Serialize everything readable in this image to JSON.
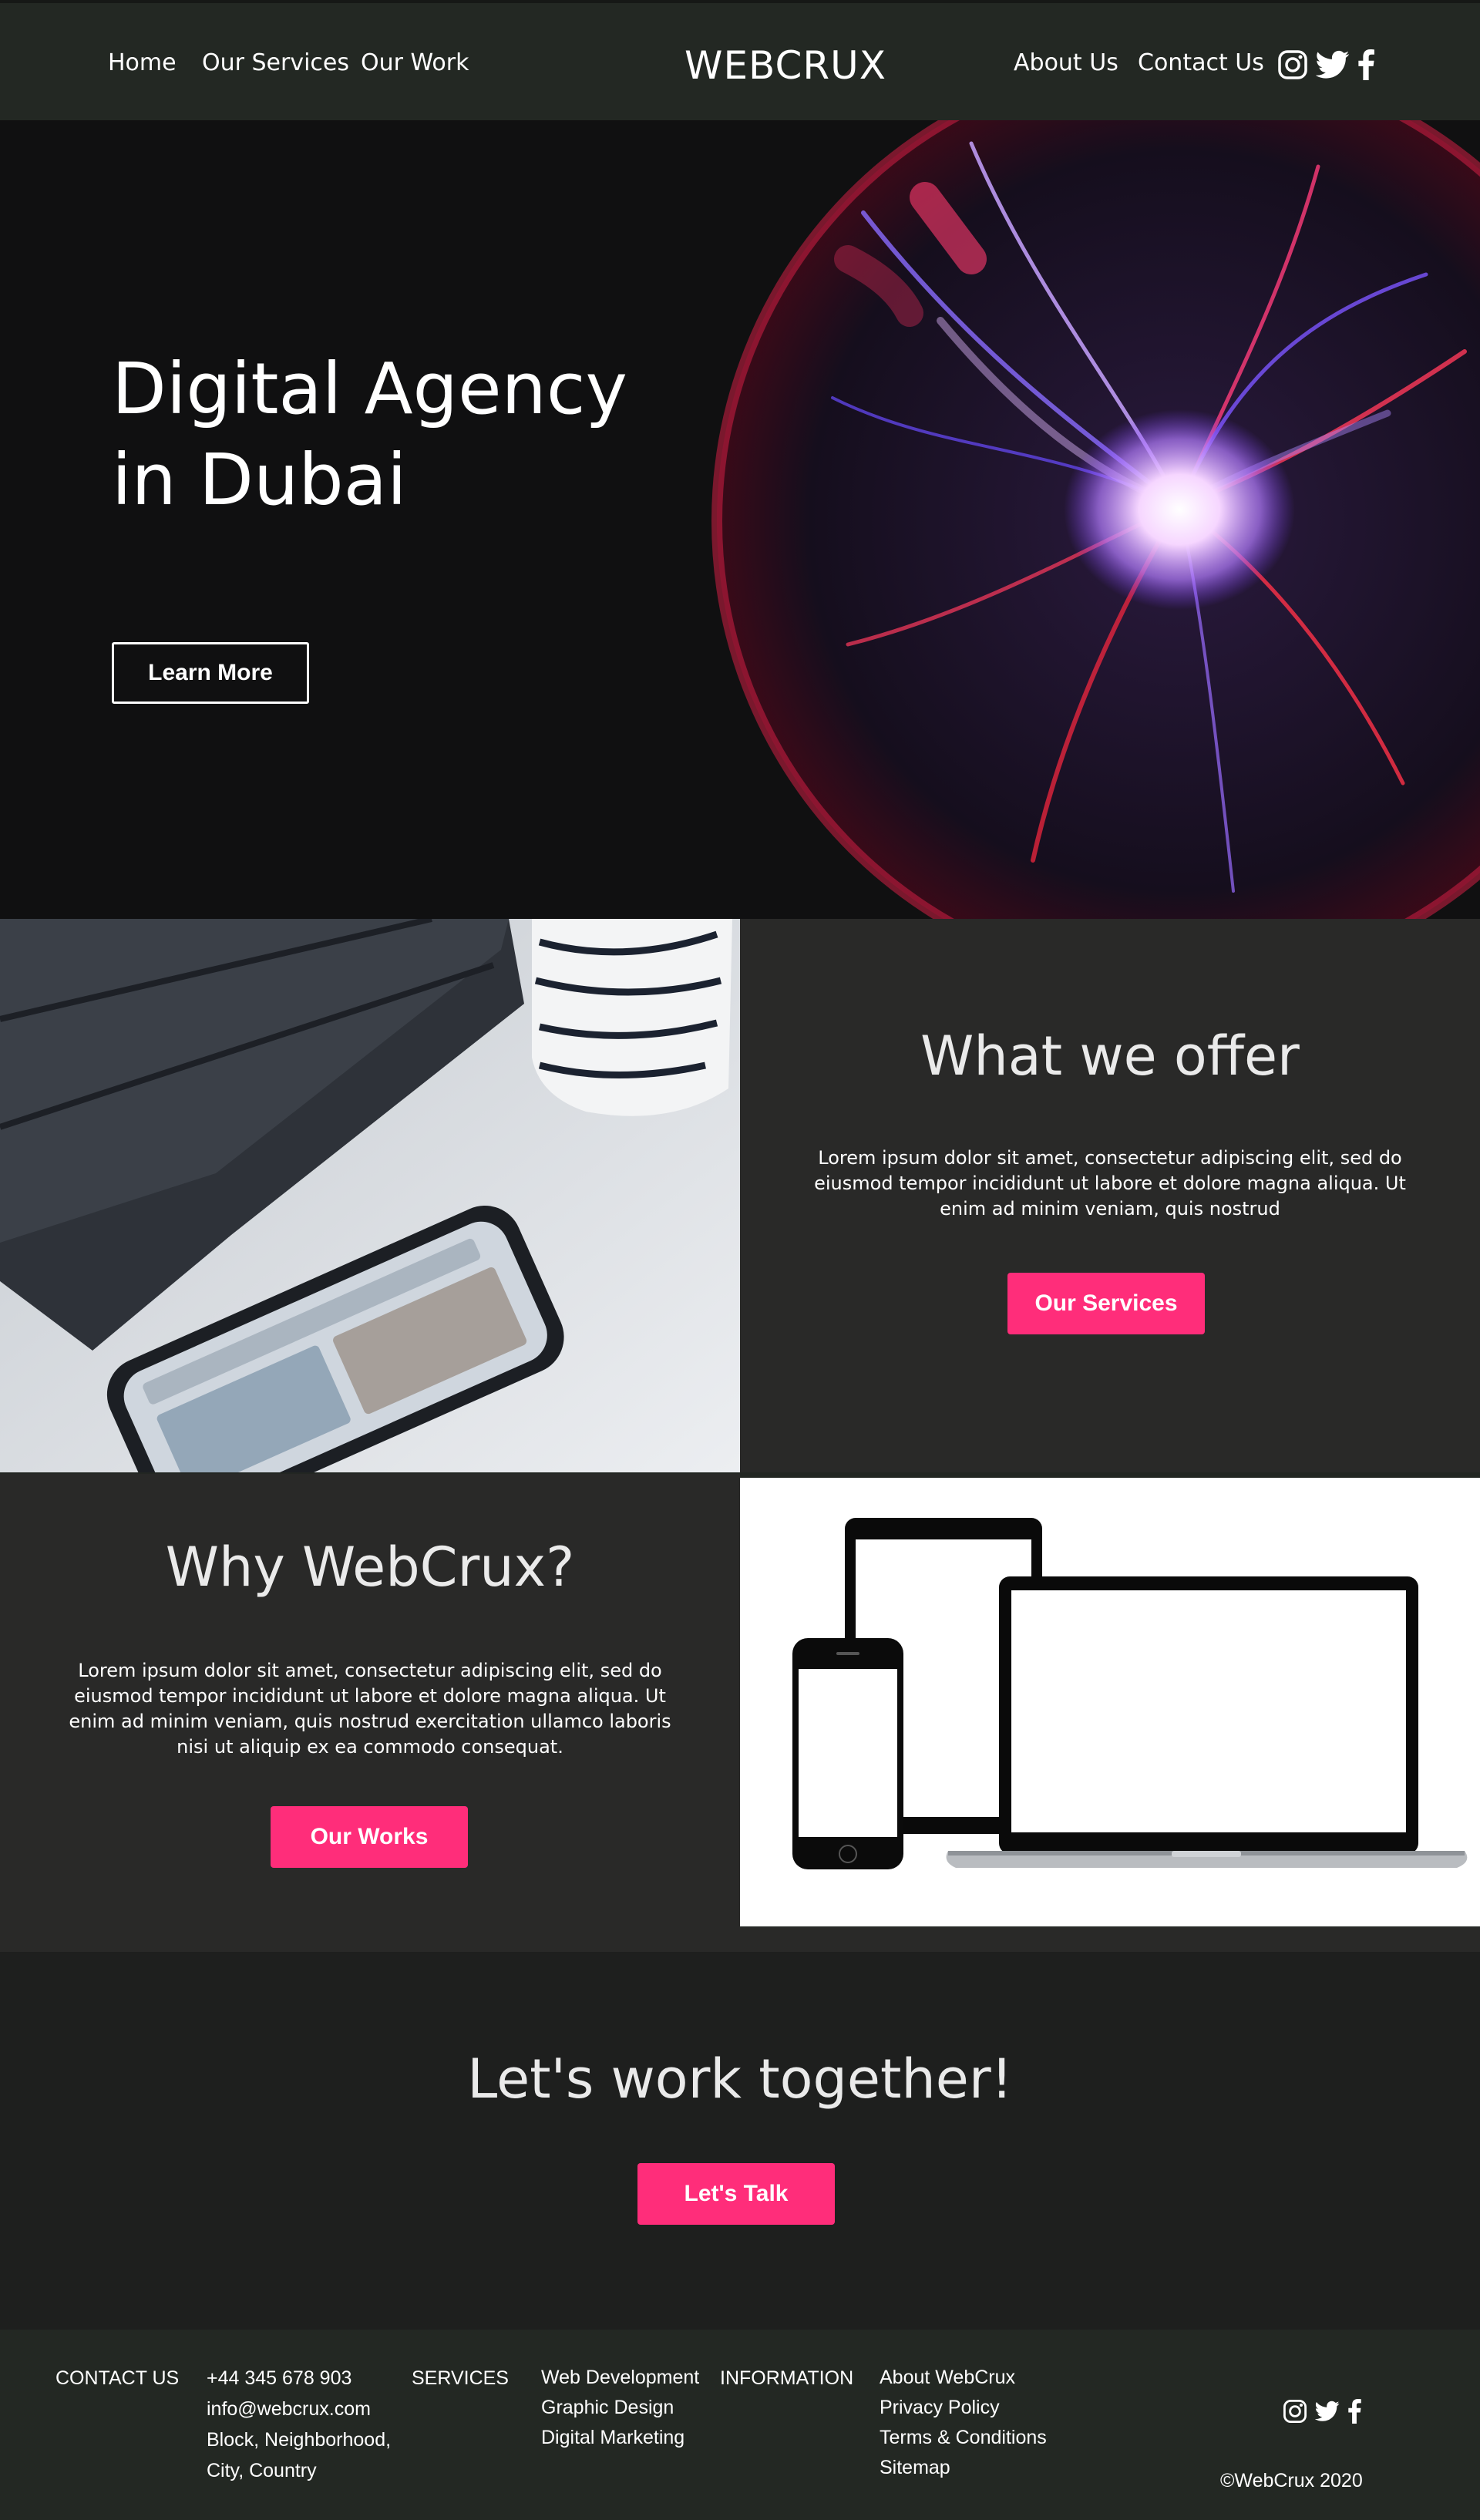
{
  "nav": {
    "left_links": [
      "Home",
      "Our Services",
      "Our Work"
    ],
    "brand": "WEBCRUX",
    "right_links": [
      "About Us",
      "Contact Us"
    ],
    "social_icons": [
      "instagram-icon",
      "twitter-icon",
      "facebook-icon"
    ]
  },
  "hero": {
    "title_line1": "Digital Agency",
    "title_line2": "in Dubai",
    "button": "Learn More"
  },
  "offer": {
    "title": "What we offer",
    "body": "Lorem ipsum dolor sit amet, consectetur adipiscing elit, sed do eiusmod tempor incididunt ut labore et dolore magna aliqua. Ut enim ad minim veniam, quis nostrud",
    "button": "Our Services"
  },
  "why": {
    "title": "Why WebCrux?",
    "body": "Lorem ipsum dolor sit amet, consectetur adipiscing elit, sed do eiusmod tempor incididunt ut labore et dolore magna aliqua. Ut enim ad minim veniam, quis nostrud exercitation ullamco laboris nisi ut aliquip ex ea commodo consequat.",
    "button": "Our Works"
  },
  "cta": {
    "title": "Let's work together!",
    "button": "Let's Talk"
  },
  "footer": {
    "contact_heading": "CONTACT US",
    "contact_lines": [
      "+44 345 678 903",
      "info@webcrux.com",
      "Block, Neighborhood,",
      "City, Country"
    ],
    "services_heading": "SERVICES",
    "services_links": [
      "Web Development",
      "Graphic Design",
      "Digital Marketing"
    ],
    "info_heading": "INFORMATION",
    "info_links": [
      "About WebCrux",
      "Privacy Policy",
      "Terms & Conditions",
      "Sitemap"
    ],
    "copyright": "©WebCrux 2020"
  },
  "colors": {
    "accent": "#ff2d7a",
    "nav_bg": "#232823",
    "section_bg": "#292928",
    "cta_bg": "#1e1f1e"
  }
}
